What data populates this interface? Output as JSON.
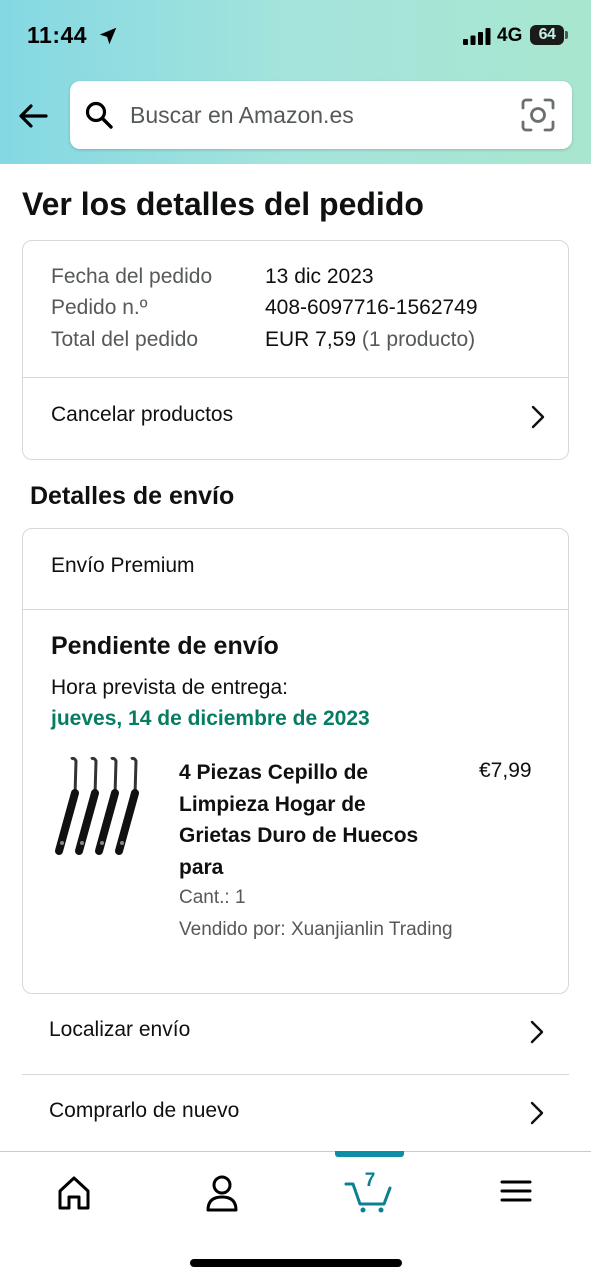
{
  "status_bar": {
    "time": "11:44",
    "network": "4G",
    "battery": "64"
  },
  "search": {
    "placeholder": "Buscar en Amazon.es"
  },
  "page": {
    "title": "Ver los detalles del pedido"
  },
  "order_summary": {
    "date_label": "Fecha del pedido",
    "date_value": "13 dic 2023",
    "number_label": "Pedido n.º",
    "number_value": "408-6097716-1562749",
    "total_label": "Total del pedido",
    "total_value": "EUR 7,59",
    "total_items": "(1 producto)",
    "cancel_label": "Cancelar productos"
  },
  "shipping": {
    "section_title": "Detalles de envío",
    "method": "Envío Premium",
    "status": "Pendiente de envío",
    "eta_label": "Hora prevista de entrega:",
    "eta_date": "jueves, 14 de diciembre de 2023",
    "eta_color": "#067d62",
    "product": {
      "name": "4 Piezas Cepillo de Limpieza Hogar de Grietas Duro de Huecos para",
      "price": "€7,99",
      "qty": "Cant.: 1",
      "seller": "Vendido por: Xuanjianlin Trading"
    }
  },
  "actions": {
    "track_label": "Localizar envío",
    "buy_again_label": "Comprarlo de nuevo"
  },
  "bottom_nav": {
    "cart_count": "7",
    "accent": "#0c8fa6",
    "items": [
      "home-icon",
      "account-icon",
      "cart-icon",
      "menu-icon"
    ]
  }
}
